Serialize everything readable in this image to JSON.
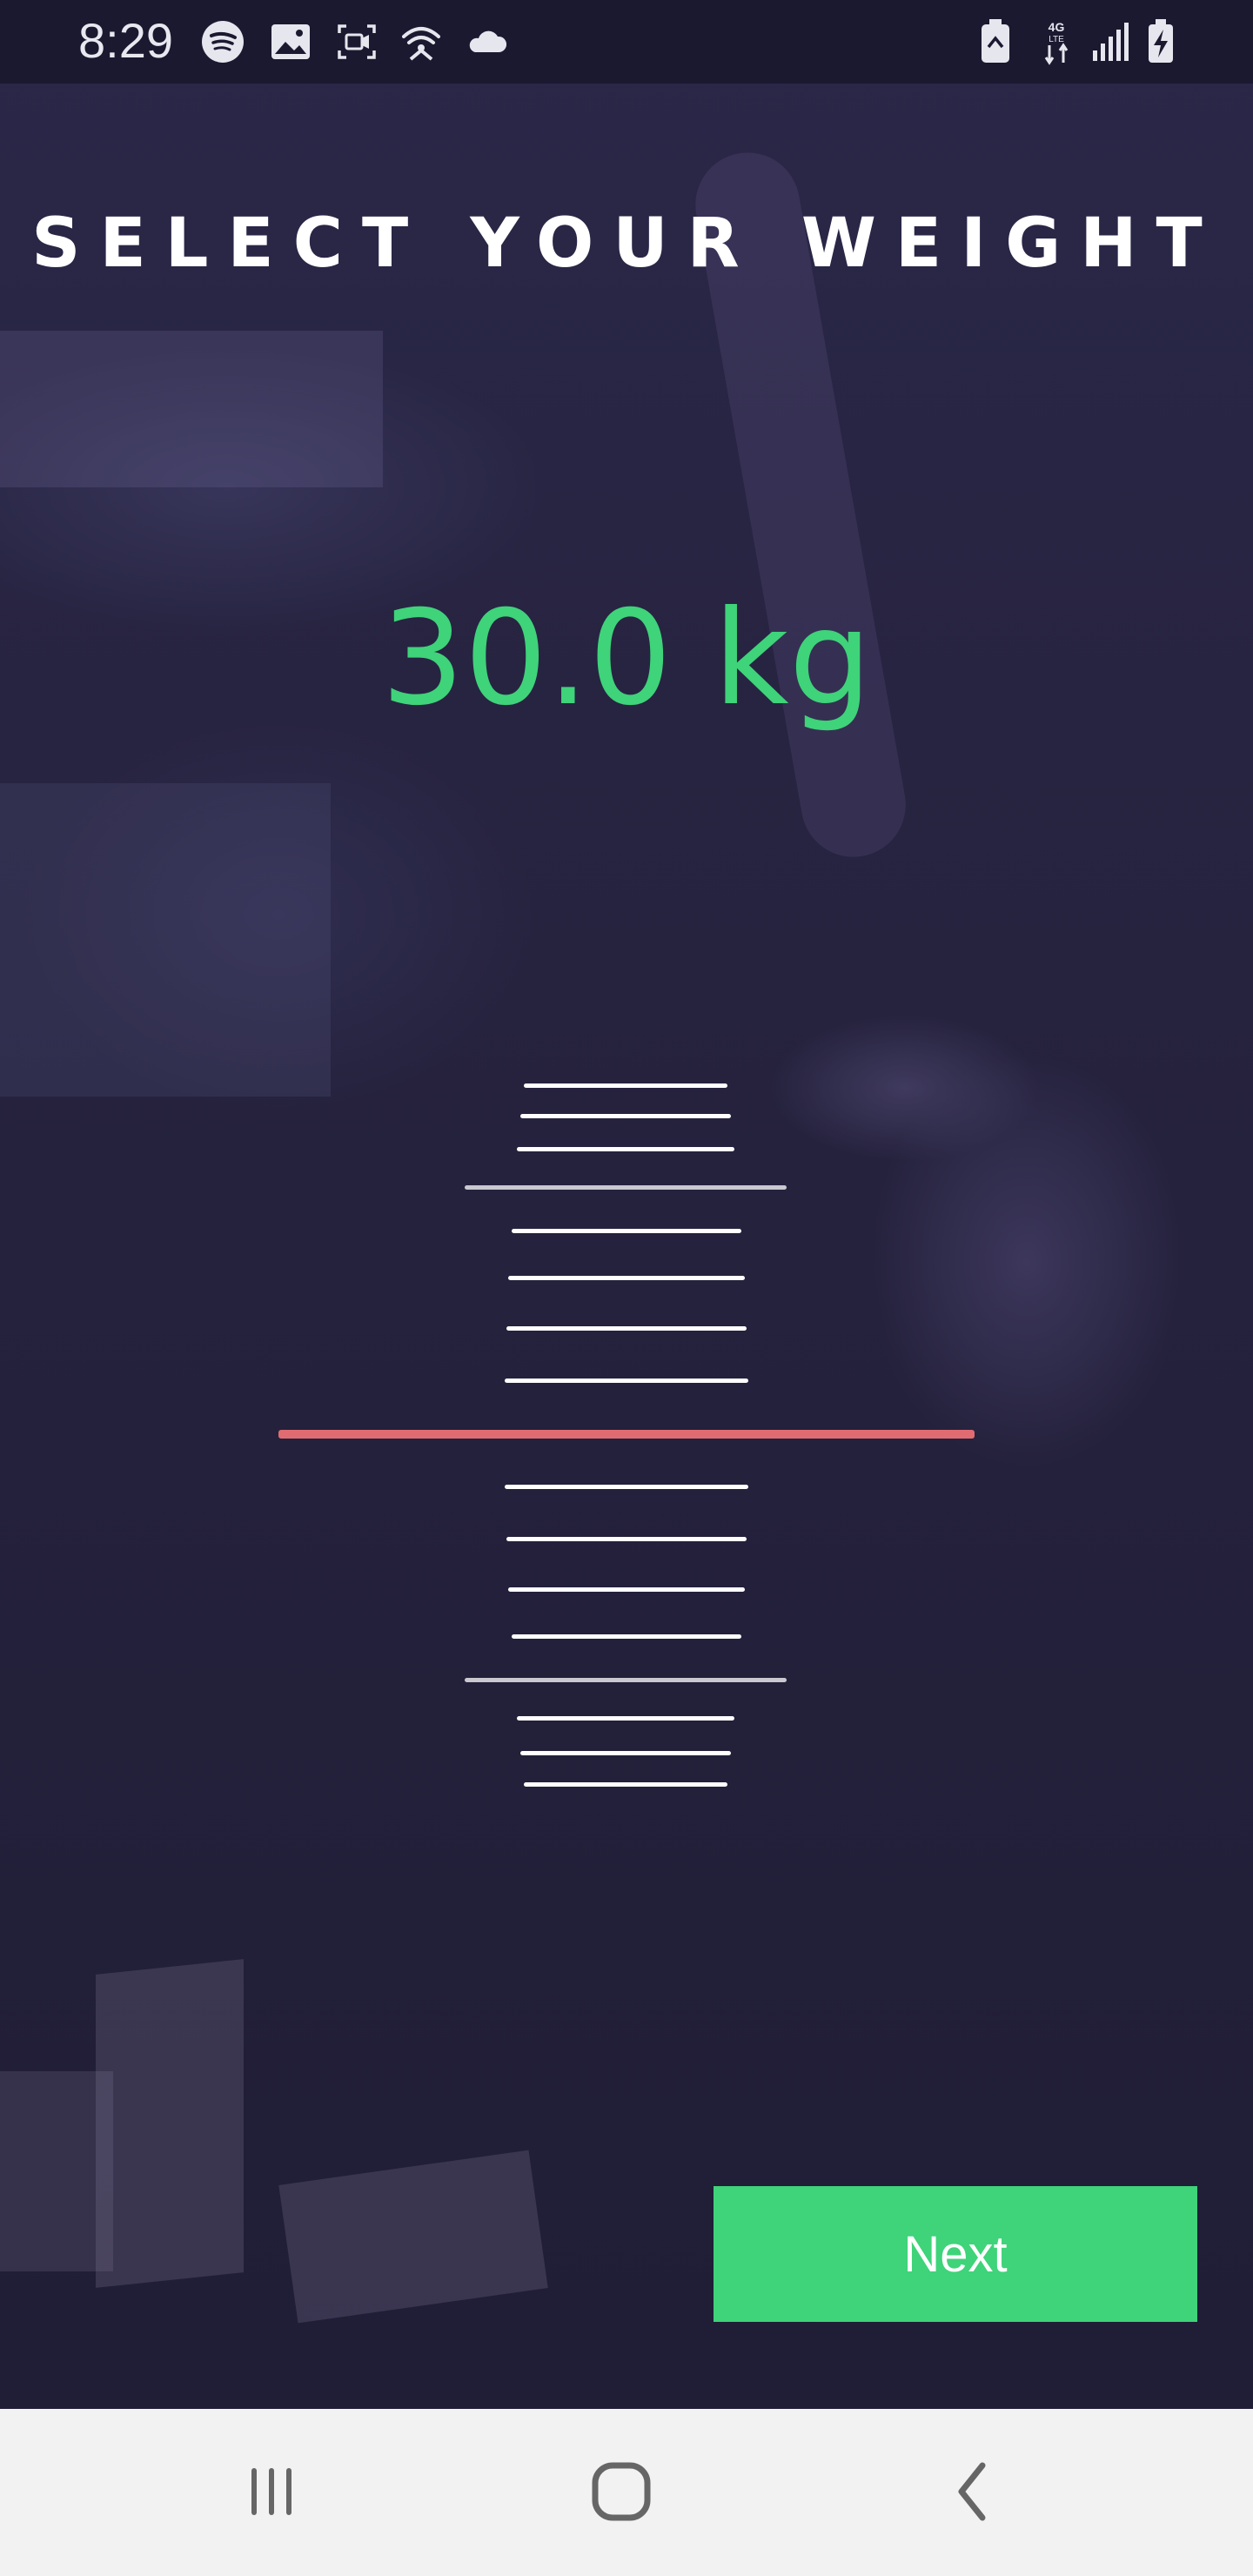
{
  "status_bar": {
    "time": "8:29",
    "left_icons": [
      "spotify-icon",
      "image-icon",
      "screen-record-icon",
      "wifi-hotspot-icon",
      "cloud-icon"
    ],
    "right_icons": [
      "battery-saver-icon",
      "4g-lte-icon",
      "signal-icon",
      "battery-charging-icon"
    ]
  },
  "header": {
    "title": "SELECT YOUR WEIGHT"
  },
  "weight": {
    "value": "30.0 kg"
  },
  "ruler": {
    "selected_value": 30.0,
    "unit": "kg",
    "indicator_color": "#e06c72"
  },
  "actions": {
    "next_label": "Next"
  },
  "colors": {
    "accent": "#3fd37a",
    "background": "#24213f",
    "indicator": "#e06c72",
    "nav_bar": "#f2f2f2"
  },
  "nav_bar": {
    "buttons": [
      "recents-icon",
      "home-icon",
      "back-icon"
    ]
  }
}
